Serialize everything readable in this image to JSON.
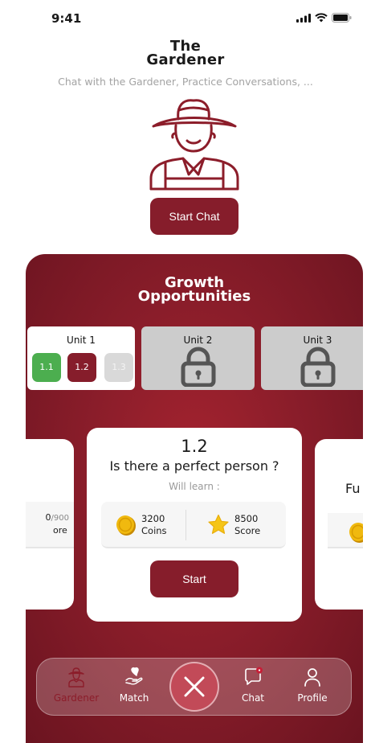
{
  "status": {
    "time": "9:41"
  },
  "app": {
    "title_line1": "The",
    "title_line2": "Gardener",
    "subtitle": "Chat with the Gardener, Practice Conversations, ...",
    "start_chat": "Start Chat"
  },
  "growth": {
    "title_line1": "Growth",
    "title_line2": "Opportunities",
    "units": [
      {
        "label": "Unit 1",
        "state": "unlocked",
        "lessons": [
          "1.1",
          "1.2",
          "1.3"
        ]
      },
      {
        "label": "Unit 2",
        "state": "locked"
      },
      {
        "label": "Unit 3",
        "state": "locked"
      }
    ],
    "lesson_colors": {
      "done": "#4cae4f",
      "current": "#861d2b",
      "upcoming": "#d9d9d9"
    }
  },
  "lesson_card": {
    "number": "1.2",
    "title": "Is there a perfect person ?",
    "will_learn": "Will learn :",
    "coins_value": "3200",
    "coins_label": "Coins",
    "score_value": "8500",
    "score_label": "Score",
    "start": "Start"
  },
  "left_card": {
    "score_fragment": "0",
    "score_total": "/900",
    "score_label_fragment": "ore"
  },
  "right_card": {
    "title_fragment": "Fu"
  },
  "nav": {
    "items": [
      {
        "label": "Gardener",
        "icon": "gardener-icon",
        "active": true
      },
      {
        "label": "Match",
        "icon": "heart-hand-icon",
        "active": false
      },
      {
        "label": "Chat",
        "icon": "chat-bubble-icon",
        "active": false
      },
      {
        "label": "Profile",
        "icon": "person-icon",
        "active": false
      }
    ],
    "fab_icon": "close-icon"
  },
  "colors": {
    "brand": "#861d2b",
    "panel": "#8a1d2a",
    "coin": "#e8b10c",
    "star": "#f5c518"
  }
}
